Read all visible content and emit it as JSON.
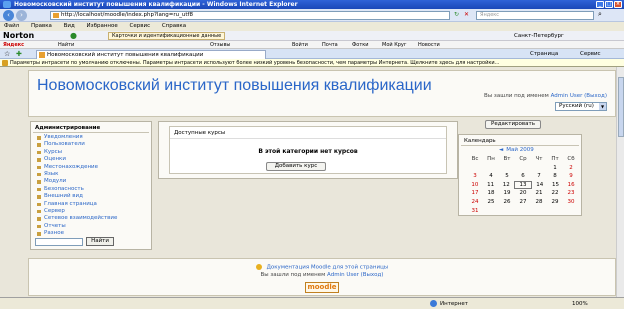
{
  "window": {
    "title": "Новомосковский институт повышения квалификации - Windows Internet Explorer"
  },
  "address": {
    "url": "http://localhost/moodle/index.php?lang=ru_utf8",
    "search_placeholder": "Яндекс"
  },
  "menu": [
    "Файл",
    "Правка",
    "Вид",
    "Избранное",
    "Сервис",
    "Справка"
  ],
  "toolbar": {
    "norton": "Norton",
    "cards_label": "Карточки и идентификационные данные",
    "weather_label": "Санкт-Петербург",
    "items": [
      "Найти",
      "Отзывы",
      "Войти",
      "Почта",
      "Фотки",
      "Мой Круг",
      "Новости"
    ]
  },
  "tab": {
    "label": "Новомосковский институт повышения квалификации",
    "page_menu": "Страница",
    "tools_menu": "Сервис"
  },
  "infobar": {
    "text": "Параметры интрасети по умолчанию отключены. Параметры интрасети используют более низкий уровень безопасности, чем параметры Интернета. Щелкните здесь для настройки..."
  },
  "header": {
    "site_title": "Новомосковский институт повышения квалификации",
    "login_prefix": "Вы зашли под именем",
    "user": "Admin User",
    "logout": "(Выход)",
    "language": "Русский (ru)"
  },
  "edit_button": "Редактировать",
  "admin_block": {
    "title": "Администрирование",
    "items": [
      "Уведомления",
      "Пользователи",
      "Курсы",
      "Оценки",
      "Местонахождение",
      "Язык",
      "Модули",
      "Безопасность",
      "Внешний вид",
      "Главная страница",
      "Сервер",
      "Сетевое взаимодействие",
      "Отчеты",
      "Разное"
    ],
    "search_button": "Найти"
  },
  "courses_block": {
    "title": "Доступные курсы",
    "empty_message": "В этой категории нет курсов",
    "add_button": "Добавить курс"
  },
  "calendar": {
    "title": "Календарь",
    "month": "Май 2009",
    "weekdays": [
      "Вс",
      "Пн",
      "Вт",
      "Ср",
      "Чт",
      "Пт",
      "Сб"
    ],
    "weeks": [
      [
        "",
        "",
        "",
        "",
        "",
        "1",
        "2"
      ],
      [
        "3",
        "4",
        "5",
        "6",
        "7",
        "8",
        "9"
      ],
      [
        "10",
        "11",
        "12",
        "13",
        "14",
        "15",
        "16"
      ],
      [
        "17",
        "18",
        "19",
        "20",
        "21",
        "22",
        "23"
      ],
      [
        "24",
        "25",
        "26",
        "27",
        "28",
        "29",
        "30"
      ],
      [
        "31",
        "",
        "",
        "",
        "",
        "",
        ""
      ]
    ],
    "today": "13"
  },
  "footer": {
    "doc_link": "Документация Moodle для этой страницы",
    "login_prefix": "Вы зашли под именем",
    "user": "Admin User",
    "logout": "(Выход)",
    "logo_text": "moodle"
  },
  "statusbar": {
    "zone": "Интернет",
    "zoom": "100%"
  }
}
